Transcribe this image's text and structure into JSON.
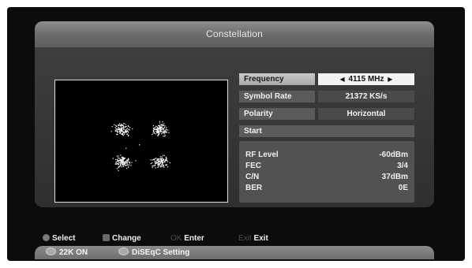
{
  "window": {
    "title": "Constellation"
  },
  "params": [
    {
      "label": "Frequency",
      "value": "4115 MHz",
      "active": true
    },
    {
      "label": "Symbol Rate",
      "value": "21372 KS/s",
      "active": false
    },
    {
      "label": "Polarity",
      "value": "Horizontal",
      "active": false
    }
  ],
  "start_label": "Start",
  "info": [
    {
      "label": "RF Level",
      "value": "-60dBm"
    },
    {
      "label": "FEC",
      "value": "3/4"
    },
    {
      "label": "C/N",
      "value": "37dBm"
    },
    {
      "label": "BER",
      "value": "0E"
    }
  ],
  "help": {
    "select": "Select",
    "change": "Change",
    "ok_key": "OK",
    "enter": "Enter",
    "exit_key": "Exit",
    "exit": "Exit"
  },
  "buttons": {
    "lnb_22k": "22K ON",
    "diseqc": "DiSEqC Setting"
  },
  "icons": {
    "select": "up-down-icon",
    "change": "left-right-icon",
    "frequency_left": "triangle-left-icon",
    "frequency_right": "triangle-right-icon"
  },
  "colors": {
    "background": "#0c0c0c",
    "panel": "#3a3a3a",
    "title_bar": "#7a7a7a",
    "highlight": "#f2f2f2",
    "constellation_dots": "#ffffff"
  }
}
